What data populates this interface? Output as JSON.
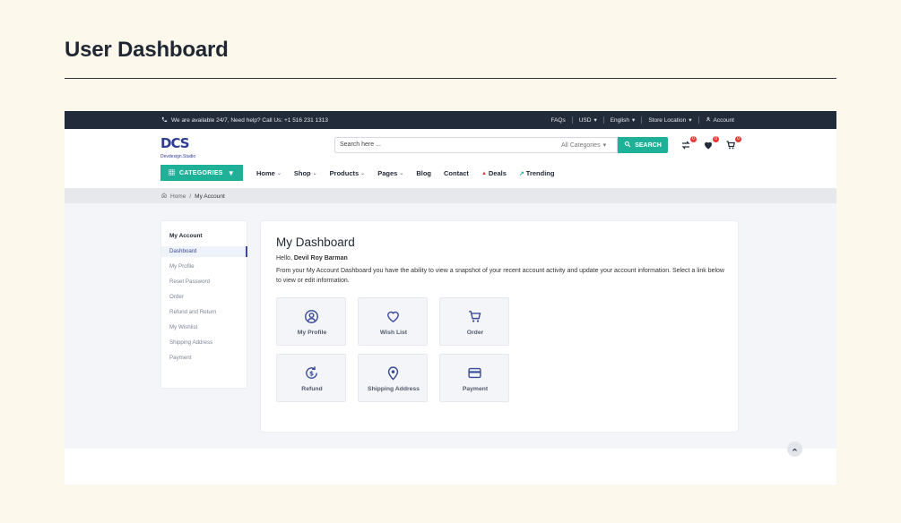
{
  "page": {
    "title": "User Dashboard"
  },
  "topbar": {
    "help_text": "We are available 24/7, Need help? Call Us: +1 516 231 1313",
    "links": [
      "FAQs",
      "USD",
      "English",
      "Store Location",
      "Account"
    ]
  },
  "header": {
    "logo_mark": "DCS",
    "logo_tagline": "Devdesign.Studio",
    "search_placeholder": "Search here ...",
    "category_select": "All Categories",
    "search_button": "SEARCH",
    "compare_count": "0",
    "wishlist_count": "0",
    "cart_count": "0"
  },
  "nav": {
    "categories_button": "CATEGORIES",
    "items": [
      "Home",
      "Shop",
      "Products",
      "Pages",
      "Blog",
      "Contact",
      "Deals",
      "Trending"
    ]
  },
  "breadcrumb": {
    "home": "Home",
    "separator": "/",
    "current": "My Account"
  },
  "sidebar": {
    "title": "My Account",
    "items": [
      "Dashboard",
      "My Profile",
      "Reset Password",
      "Order",
      "Refund and Return",
      "My Wishlist",
      "Shipping Address",
      "Payment"
    ]
  },
  "dashboard": {
    "title": "My Dashboard",
    "greeting": "Hello,",
    "user_name": "Devil Roy Barman",
    "description": "From your My Account Dashboard you have the ability to view a snapshot of your recent account activity and update your account information. Select a link below to view or edit information.",
    "tiles": [
      "My Profile",
      "Wish List",
      "Order",
      "Refund",
      "Shipping Address",
      "Payment"
    ]
  },
  "colors": {
    "accent": "#1fb198",
    "primary": "#3a4a9a",
    "dark": "#222b3a",
    "background": "#fdf8ec"
  },
  "icons": [
    "phone-icon",
    "user-icon",
    "search-icon",
    "compare-icon",
    "heart-icon",
    "cart-icon",
    "grid-icon",
    "home-icon",
    "profile-icon",
    "refund-icon",
    "location-icon",
    "card-icon",
    "chevron-up-icon"
  ]
}
